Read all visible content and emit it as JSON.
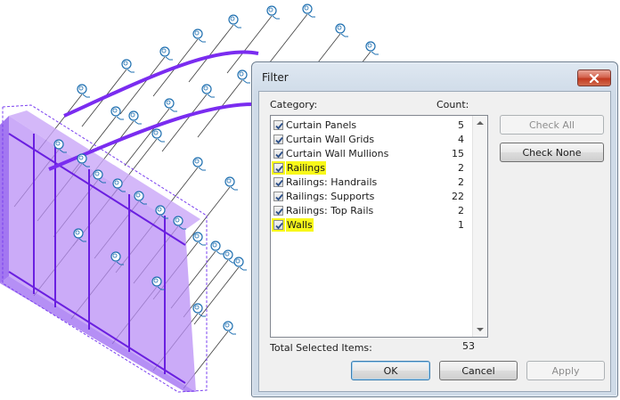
{
  "dialog": {
    "title": "Filter",
    "category_header": "Category:",
    "count_header": "Count:",
    "categories": [
      {
        "label": "Curtain Panels",
        "count": "5",
        "checked": true,
        "highlight": false
      },
      {
        "label": "Curtain Wall Grids",
        "count": "4",
        "checked": true,
        "highlight": false
      },
      {
        "label": "Curtain Wall Mullions",
        "count": "15",
        "checked": true,
        "highlight": false
      },
      {
        "label": "Railings",
        "count": "2",
        "checked": true,
        "highlight": true
      },
      {
        "label": "Railings: Handrails",
        "count": "2",
        "checked": true,
        "highlight": false
      },
      {
        "label": "Railings: Supports",
        "count": "22",
        "checked": true,
        "highlight": false
      },
      {
        "label": "Railings: Top Rails",
        "count": "2",
        "checked": true,
        "highlight": false
      },
      {
        "label": "Walls",
        "count": "1",
        "checked": true,
        "highlight": true
      }
    ],
    "total_label": "Total Selected Items:",
    "total_value": "53",
    "check_all_label": "Check All",
    "check_none_label": "Check None",
    "ok_label": "OK",
    "cancel_label": "Cancel",
    "apply_label": "Apply"
  },
  "colors": {
    "wall": "#9b5df0",
    "wall_edge": "#6a1fe0",
    "railing": "#7a2cf0",
    "tag_line": "#3c3c3c",
    "tag": "#1e6fb0",
    "highlight": "#f8f81a"
  },
  "icons": [
    "close-icon",
    "checkmark-icon",
    "scroll-up-arrow-icon",
    "scroll-down-arrow-icon",
    "tag-marker-icon"
  ]
}
